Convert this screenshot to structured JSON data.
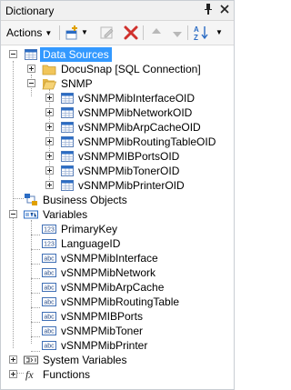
{
  "panel": {
    "title": "Dictionary",
    "pin_icon": "pin-icon",
    "close_icon": "close-icon"
  },
  "toolbar": {
    "actions_label": "Actions",
    "icons": [
      "new-item-icon",
      "edit-icon",
      "delete-icon",
      "move-up-icon",
      "move-down-icon",
      "sort-icon"
    ]
  },
  "tree": {
    "data_sources": {
      "label": "Data Sources",
      "connection": "DocuSnap [SQL Connection]",
      "snmp": "SNMP",
      "tables": [
        "vSNMPMibInterfaceOID",
        "vSNMPMibNetworkOID",
        "vSNMPMibArpCacheOID",
        "vSNMPMibRoutingTableOID",
        "vSNMPMIBPortsOID",
        "vSNMPMibTonerOID",
        "vSNMPMibPrinterOID"
      ]
    },
    "business_objects": "Business Objects",
    "variables": {
      "label": "Variables",
      "items": [
        {
          "name": "PrimaryKey",
          "type_badge": "123"
        },
        {
          "name": "LanguageID",
          "type_badge": "123"
        },
        {
          "name": "vSNMPMibInterface",
          "type_badge": "abc"
        },
        {
          "name": "vSNMPMibNetwork",
          "type_badge": "abc"
        },
        {
          "name": "vSNMPMibArpCache",
          "type_badge": "abc"
        },
        {
          "name": "vSNMPMibRoutingTable",
          "type_badge": "abc"
        },
        {
          "name": "vSNMPMIBPorts",
          "type_badge": "abc"
        },
        {
          "name": "vSNMPMibToner",
          "type_badge": "abc"
        },
        {
          "name": "vSNMPMibPrinter",
          "type_badge": "abc"
        }
      ]
    },
    "system_variables": "System Variables",
    "functions": "Functions"
  },
  "colors": {
    "selection": "#3399ff",
    "accent_blue": "#2b6cc4",
    "delete_red": "#d0312d",
    "folder": "#e8b84a"
  }
}
